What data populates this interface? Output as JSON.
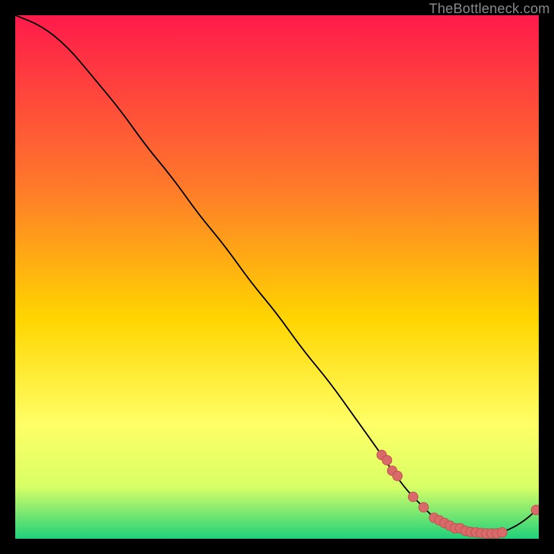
{
  "watermark": "TheBottleneck.com",
  "colors": {
    "gradient_top": "#ff1a4b",
    "gradient_mid1": "#ff7a2a",
    "gradient_mid2": "#ffd500",
    "gradient_mid3": "#ffff66",
    "gradient_mid4": "#d9ff66",
    "gradient_bottom": "#1fd17a",
    "curve": "#000000",
    "marker_fill": "#d86a6a",
    "marker_stroke": "#c24f4f"
  },
  "chart_data": {
    "type": "line",
    "xlim": [
      0,
      100
    ],
    "ylim": [
      0,
      100
    ],
    "xlabel": "",
    "ylabel": "",
    "title": "",
    "grid": false,
    "series": [
      {
        "name": "bottleneck-curve",
        "x": [
          0,
          5,
          10,
          15,
          20,
          25,
          30,
          35,
          40,
          45,
          50,
          55,
          60,
          65,
          70,
          72,
          75,
          78,
          80,
          82,
          85,
          88,
          90,
          92,
          95,
          98,
          100
        ],
        "y": [
          100,
          98,
          94,
          88,
          82,
          75,
          69,
          62,
          56,
          49,
          43,
          36,
          30,
          23,
          16,
          13,
          9,
          6,
          4,
          3,
          2,
          1,
          1,
          1,
          2,
          4,
          6
        ]
      }
    ],
    "markers": {
      "name": "highlighted-points",
      "x": [
        70,
        71,
        72,
        73,
        76,
        78,
        80,
        81,
        82,
        83,
        84,
        85,
        86,
        87,
        88,
        89,
        90,
        91,
        92,
        93,
        99.5
      ],
      "y": [
        16,
        15,
        13,
        12,
        8,
        6,
        4,
        3.5,
        3,
        2.5,
        2,
        2,
        1.5,
        1.3,
        1.2,
        1.1,
        1,
        1,
        1,
        1.2,
        5.5
      ]
    }
  }
}
